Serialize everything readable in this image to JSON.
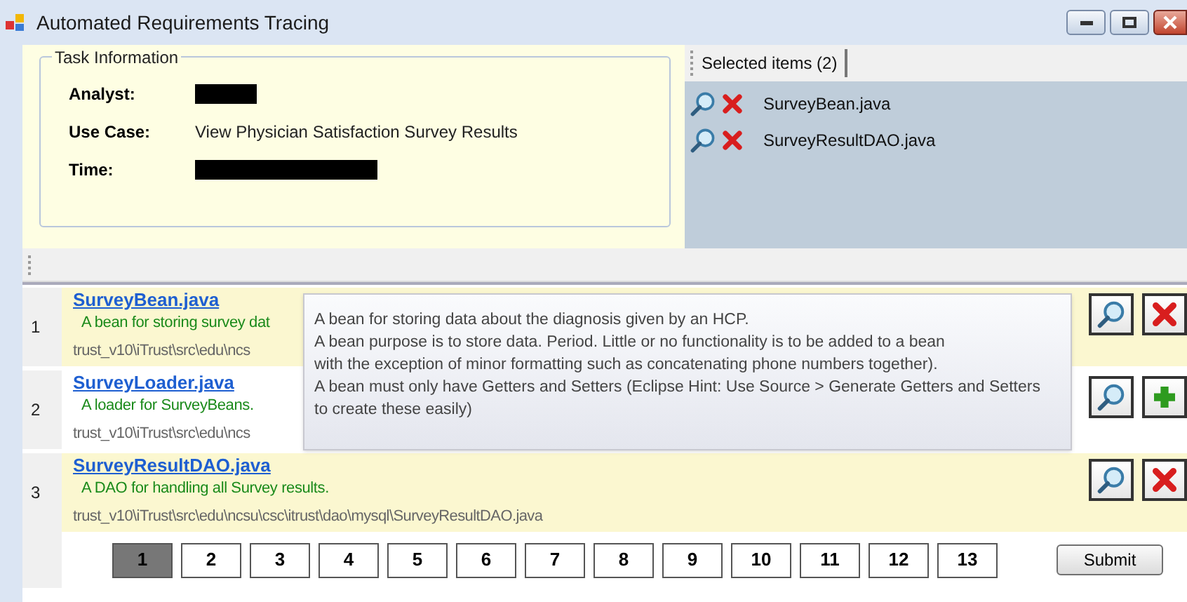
{
  "window": {
    "title": "Automated Requirements Tracing"
  },
  "task_information": {
    "title": "Task Information",
    "fields": [
      {
        "label": "Analyst:",
        "redacted": true
      },
      {
        "label": "Use Case:",
        "value": "View Physician Satisfaction Survey Results"
      },
      {
        "label": "Time:",
        "redacted": true
      }
    ]
  },
  "selected_items": {
    "tab": "Selected items (2)",
    "items": [
      "SurveyBean.java",
      "SurveyResultDAO.java"
    ]
  },
  "results": [
    {
      "number": "1",
      "file": "SurveyBean.java",
      "description": "A bean for storing survey dat",
      "path": "trust_v10\\iTrust\\src\\edu\\ncs",
      "selected": true,
      "kind": "removable"
    },
    {
      "number": "2",
      "file": "SurveyLoader.java",
      "description": "A loader for SurveyBeans.",
      "path": "trust_v10\\iTrust\\src\\edu\\ncs",
      "selected": false,
      "kind": "addable"
    },
    {
      "number": "3",
      "file": "SurveyResultDAO.java",
      "description": "A DAO for handling all Survey results.",
      "path": "trust_v10\\iTrust\\src\\edu\\ncsu\\csc\\itrust\\dao\\mysql\\SurveyResultDAO.java",
      "selected": true,
      "kind": "removable"
    }
  ],
  "tooltip": [
    "A bean for storing data about the diagnosis given by an HCP.",
    "A bean purpose is to store data. Period. Little or no functionality is to be added to a bean",
    "with the exception of minor formatting such as concatenating phone numbers together).",
    "A bean must only have Getters and Setters (Eclipse Hint: Use Source > Generate Getters and Setters",
    "to create these easily)"
  ],
  "pages": [
    {
      "label": "1",
      "selected": true
    },
    {
      "label": "2",
      "selected": false
    },
    {
      "label": "3",
      "selected": false
    },
    {
      "label": "4",
      "selected": false
    },
    {
      "label": "5",
      "selected": false
    },
    {
      "label": "6",
      "selected": false
    },
    {
      "label": "7",
      "selected": false
    },
    {
      "label": "8",
      "selected": false
    },
    {
      "label": "9",
      "selected": false
    },
    {
      "label": "10",
      "selected": false
    },
    {
      "label": "11",
      "selected": false
    },
    {
      "label": "12",
      "selected": false
    },
    {
      "label": "13",
      "selected": false
    }
  ],
  "submit": "Submit"
}
